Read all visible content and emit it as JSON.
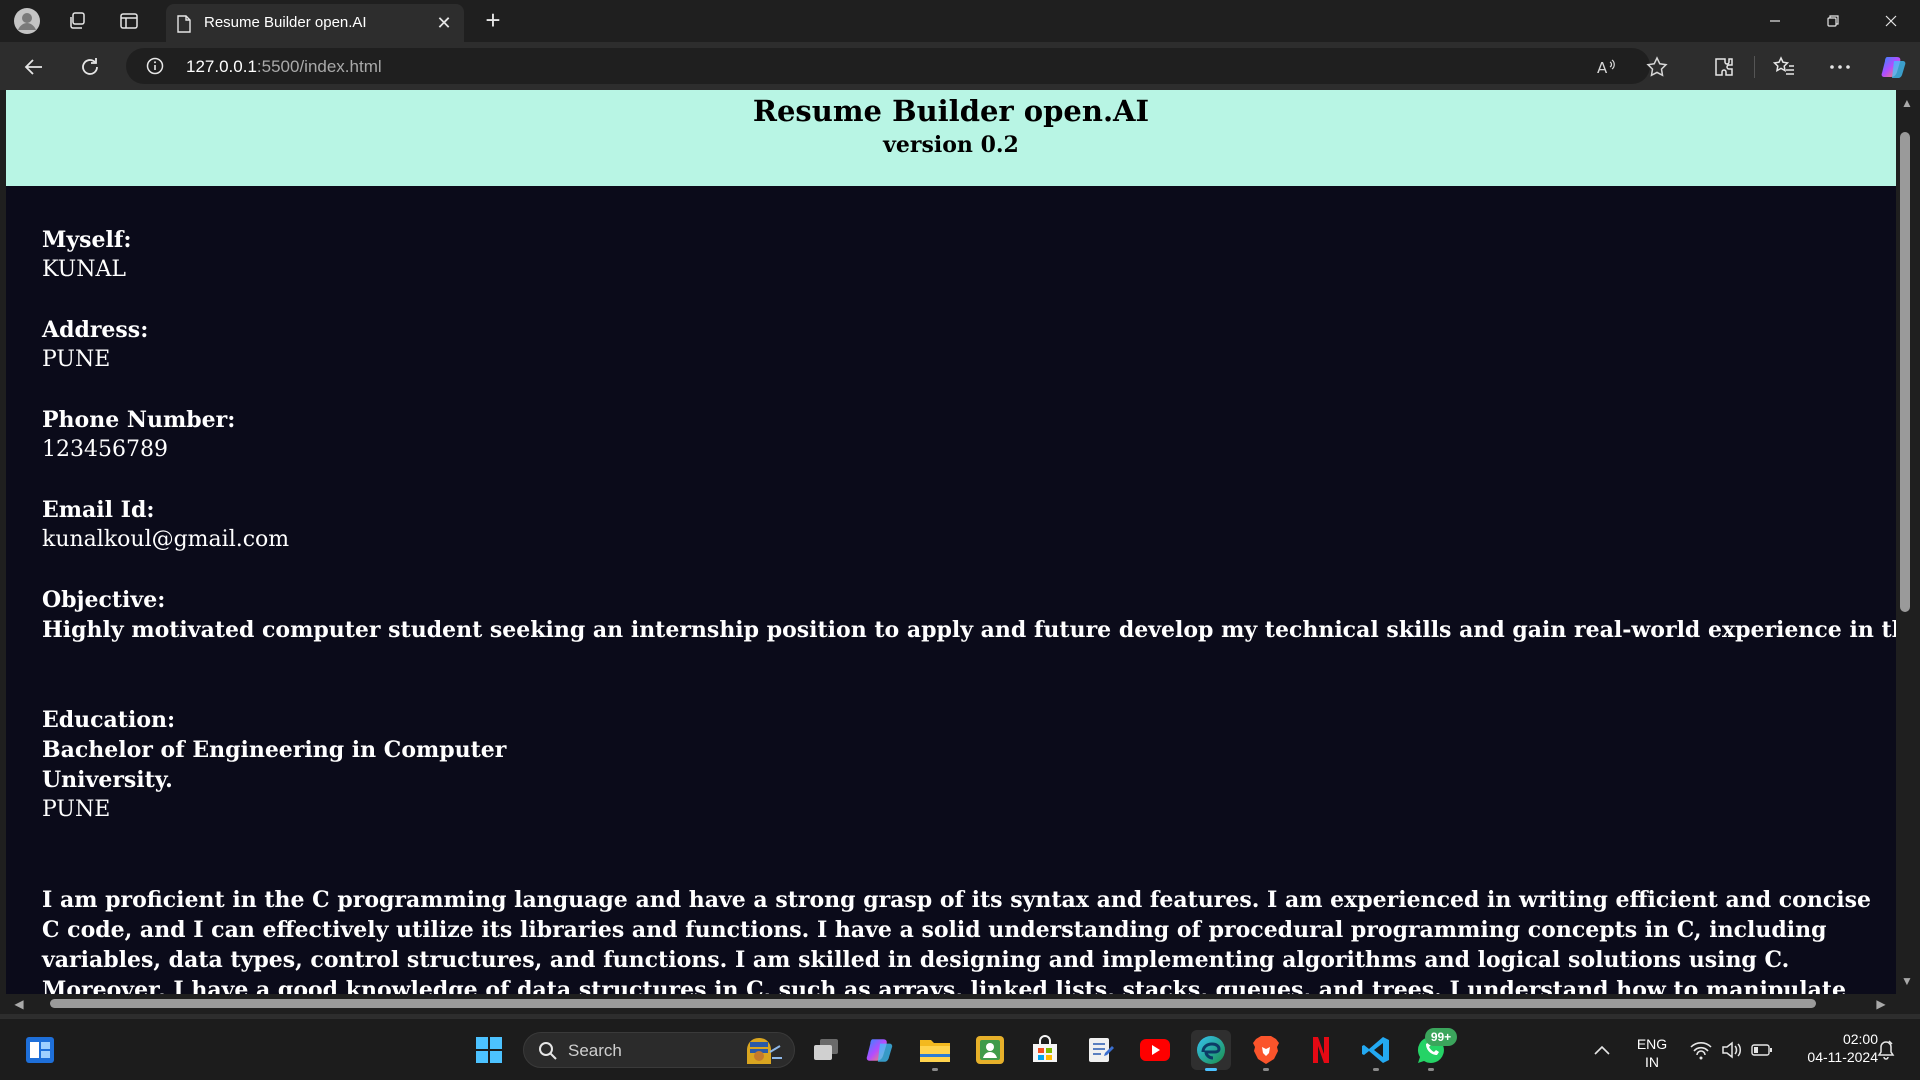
{
  "browser": {
    "tab_title": "Resume Builder open.AI",
    "url_host": "127.0.0.1",
    "url_path": ":5500/index.html"
  },
  "header": {
    "title": "Resume Builder open.AI",
    "version": "version 0.2"
  },
  "resume": {
    "myself_label": "Myself:",
    "myself_value": "KUNAL",
    "address_label": "Address:",
    "address_value": "PUNE",
    "phone_label": "Phone Number:",
    "phone_value": "123456789",
    "email_label": "Email Id:",
    "email_value": "kunalkoul@gmail.com",
    "objective_label": "Objective:",
    "objective_value": "Highly motivated computer student seeking an internship position to apply and future develop my technical skills and gain real-world experience in the industry.",
    "education_label": "Education:",
    "education_degree": "Bachelor of Engineering in Computer",
    "education_university": "University.",
    "education_city": "PUNE",
    "skills_paragraph": "I am proficient in the C programming language and have a strong grasp of its syntax and features. I am experienced in writing efficient and concise C code, and I can effectively utilize its libraries and functions. I have a solid understanding of procedural programming concepts in C, including variables, data types, control structures, and functions. I am skilled in designing and implementing algorithms and logical solutions using C. Moreover, I have a good knowledge of data structures in C, such as arrays, linked lists, stacks, queues, and trees. I understand how to manipulate and optimize data structures for various programming"
  },
  "taskbar": {
    "search_placeholder": "Search",
    "whatsapp_badge": "99+",
    "lang_line1": "ENG",
    "lang_line2": "IN",
    "time": "02:00",
    "date": "04-11-2024"
  },
  "colors": {
    "header_bg": "#b8f5e4",
    "page_bg": "#0b0b1a",
    "browser_chrome": "#1f1f1f",
    "taskbar_active_indicator": "#4cc2ff"
  }
}
